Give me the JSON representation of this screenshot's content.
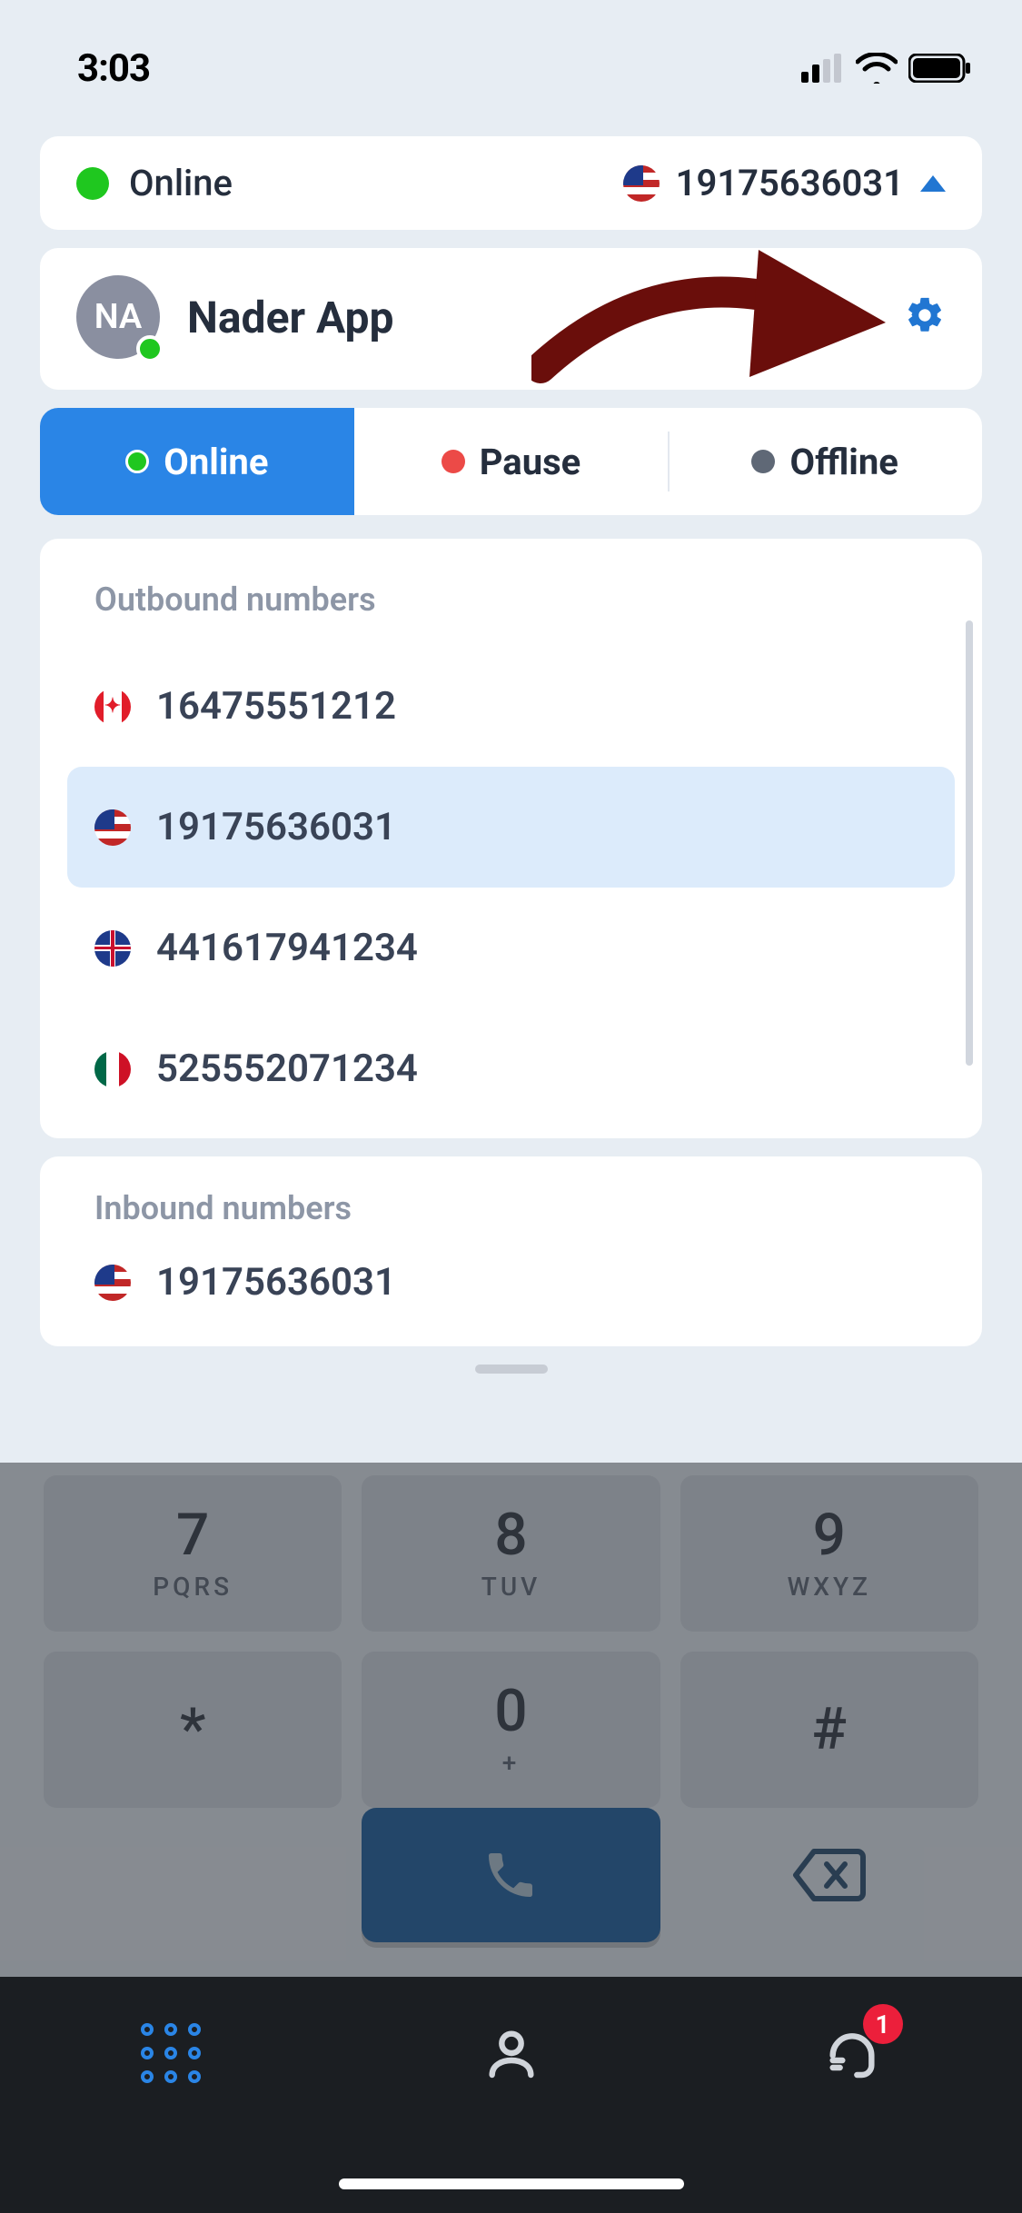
{
  "status_bar": {
    "time": "3:03"
  },
  "header": {
    "status_dot_color": "#1fc71f",
    "status_text": "Online",
    "selected_number_flag": "us",
    "selected_number": "19175636031"
  },
  "profile": {
    "avatar_initials": "NA",
    "presence_color": "#1fc71f",
    "name": "Nader App"
  },
  "segmented": {
    "options": [
      {
        "id": "online",
        "label": "Online",
        "dot": "green",
        "active": true
      },
      {
        "id": "pause",
        "label": "Pause",
        "dot": "red",
        "active": false
      },
      {
        "id": "offline",
        "label": "Offline",
        "dot": "grey",
        "active": false
      }
    ]
  },
  "sections": {
    "outbound_title": "Outbound numbers",
    "inbound_title": "Inbound numbers"
  },
  "outbound_numbers": [
    {
      "flag": "ca",
      "number": "16475551212",
      "selected": false
    },
    {
      "flag": "us",
      "number": "19175636031",
      "selected": true
    },
    {
      "flag": "uk",
      "number": "441617941234",
      "selected": false
    },
    {
      "flag": "mx",
      "number": "525552071234",
      "selected": false
    }
  ],
  "inbound_numbers": [
    {
      "flag": "us",
      "number": "19175636031",
      "selected": false
    }
  ],
  "keypad": {
    "keys": [
      {
        "digit": "7",
        "letters": "PQRS"
      },
      {
        "digit": "8",
        "letters": "TUV"
      },
      {
        "digit": "9",
        "letters": "WXYZ"
      },
      {
        "digit": "*",
        "letters": ""
      },
      {
        "digit": "0",
        "letters": "+"
      },
      {
        "digit": "#",
        "letters": ""
      }
    ]
  },
  "bottom_nav": {
    "badge_count": "1"
  },
  "colors": {
    "accent_blue": "#2a85e6",
    "arrow": "#6a0e0b"
  }
}
